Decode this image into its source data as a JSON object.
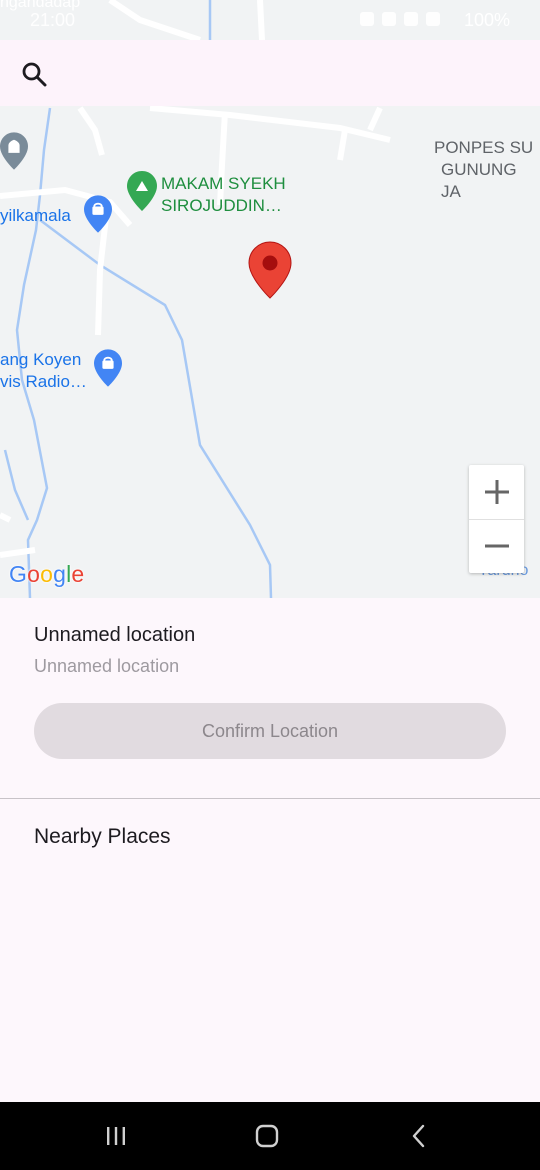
{
  "status_bar": {
    "time": "21:00",
    "battery": "100%"
  },
  "search": {
    "icon": "search-icon"
  },
  "map": {
    "pois": [
      {
        "line1": "MAKAM SYEKH",
        "line2": "SIROJUDDIN…",
        "icon": "cemetery-pin-icon"
      },
      {
        "line1": "yilkamala",
        "icon": "shopping-pin-icon"
      },
      {
        "line1": "ang Koyen",
        "line2": "vis Radio…",
        "icon": "shopping-pin-icon"
      },
      {
        "line1": "PONPES SU",
        "line2": "GUNUNG JA"
      }
    ],
    "area_labels": {
      "top": "ngandadap",
      "bottom_right": "Yardno"
    },
    "zoom_in": "+",
    "zoom_out": "−",
    "attribution": "Google",
    "colors": {
      "marker": "#ea4335",
      "water": "#a7c8f5",
      "road": "#ffffff",
      "land": "#f1f3f4"
    }
  },
  "location": {
    "title": "Unnamed location",
    "subtitle": "Unnamed location",
    "confirm_label": "Confirm Location"
  },
  "nearby": {
    "title": "Nearby Places"
  },
  "nav": {
    "recents": "recents-icon",
    "home": "home-icon",
    "back": "back-icon"
  }
}
